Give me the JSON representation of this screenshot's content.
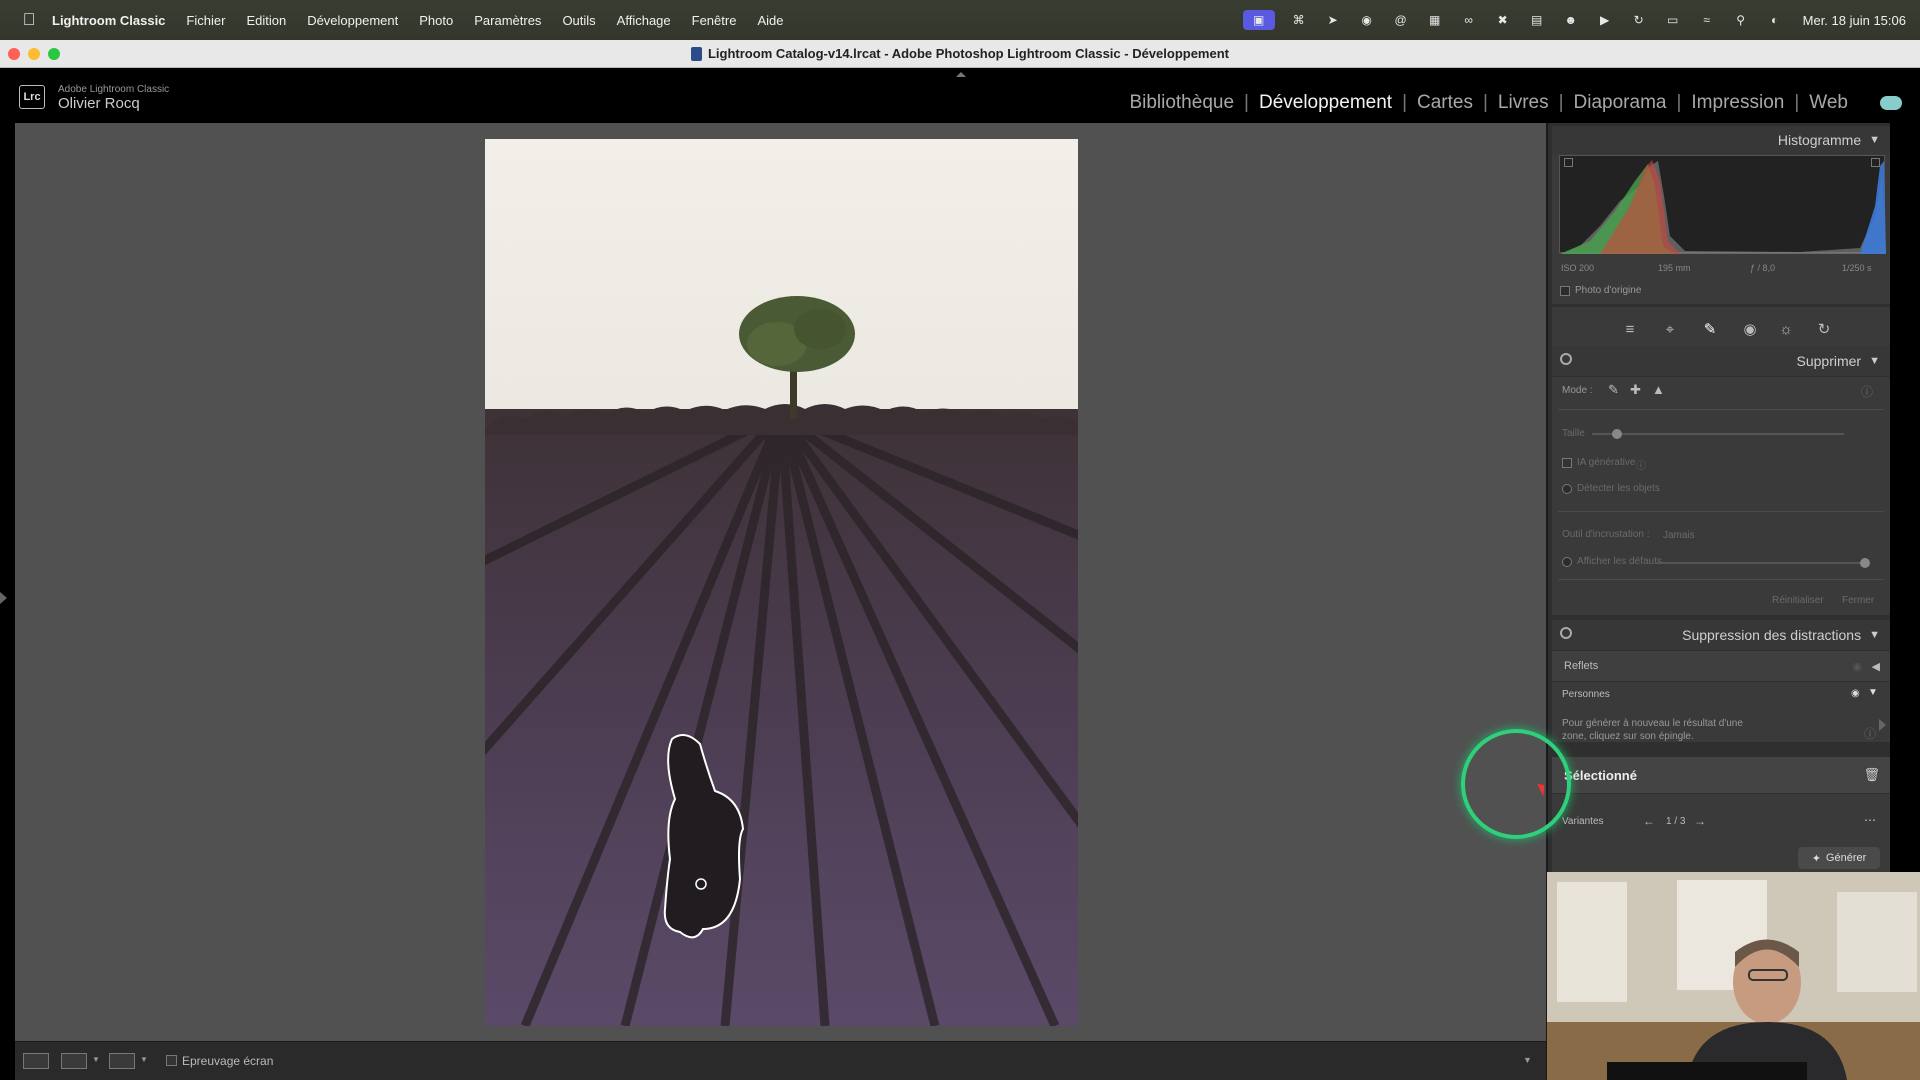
{
  "menubar": {
    "app_name": "Lightroom Classic",
    "menus": [
      "Fichier",
      "Edition",
      "Développement",
      "Photo",
      "Paramètres",
      "Outils",
      "Affichage",
      "Fenêtre",
      "Aide"
    ],
    "clock": "Mer. 18 juin  15:06"
  },
  "window": {
    "title": "Lightroom Catalog-v14.lrcat - Adobe Photoshop Lightroom Classic - Développement"
  },
  "identity": {
    "app": "Adobe Lightroom Classic",
    "user": "Olivier Rocq",
    "logo": "Lrc"
  },
  "modules": [
    "Bibliothèque",
    "Développement",
    "Cartes",
    "Livres",
    "Diaporama",
    "Impression",
    "Web"
  ],
  "active_module": "Développement",
  "histogram": {
    "title": "Histogramme",
    "iso": "ISO 200",
    "focal": "195 mm",
    "aperture": "ƒ / 8,0",
    "shutter": "1/250 s",
    "original_photo": "Photo d'origine"
  },
  "remove_panel": {
    "title": "Supprimer",
    "mode_label": "Mode :",
    "size_label": "Taille",
    "size_value": 0.1,
    "generative_ai": "IA générative",
    "detect_objects": "Détecter les objets",
    "overlay_label": "Outil d'incrustation :",
    "overlay_value": "Jamais",
    "show_defaults": "Afficher les défauts",
    "reset": "Réinitialiser",
    "close": "Fermer"
  },
  "distraction_panel": {
    "title": "Suppression des distractions",
    "reflections": "Reflets",
    "people": "Personnes",
    "hint": "Pour générer à nouveau le résultat d'une zone, cliquez sur son épingle.",
    "selected": "Sélectionné",
    "variants_label": "Variantes",
    "variants_value": "1 / 3",
    "generate": "Générer"
  },
  "bottombar": {
    "soft_proof": "Epreuvage écran"
  }
}
